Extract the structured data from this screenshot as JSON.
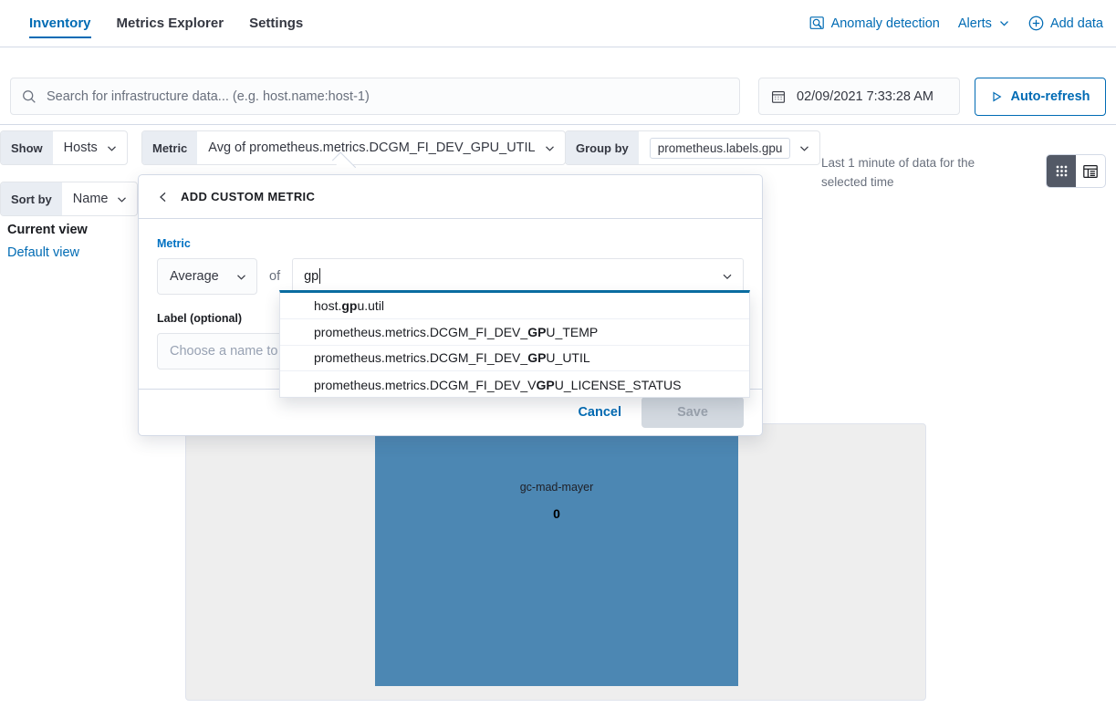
{
  "nav": {
    "tabs": [
      {
        "label": "Inventory",
        "active": true
      },
      {
        "label": "Metrics Explorer",
        "active": false
      },
      {
        "label": "Settings",
        "active": false
      }
    ],
    "right": {
      "anomaly_label": "Anomaly detection",
      "alerts_label": "Alerts",
      "add_data_label": "Add data"
    }
  },
  "search": {
    "placeholder": "Search for infrastructure data... (e.g. host.name:host-1)",
    "value": ""
  },
  "date": {
    "value": "02/09/2021 7:33:28 AM"
  },
  "refresh": {
    "label": "Auto-refresh"
  },
  "toolbar": {
    "show_label": "Show",
    "show_value": "Hosts",
    "metric_label": "Metric",
    "metric_value": "Avg of prometheus.metrics.DCGM_FI_DEV_GPU_UTIL",
    "groupby_label": "Group by",
    "groupby_value": "prometheus.labels.gpu",
    "hint": "Last 1 minute of data for the selected time"
  },
  "sidebar": {
    "sort_label": "Sort by",
    "sort_value": "Name",
    "current_view": "Current view",
    "default_view": "Default view"
  },
  "panel": {
    "title": "ADD CUSTOM METRIC",
    "metric_field_label": "Metric",
    "agg_value": "Average",
    "of_text": "of",
    "metric_input_value": "gp",
    "label_field_label": "Label (optional)",
    "label_placeholder": "Choose a name to a",
    "cancel_label": "Cancel",
    "save_label": "Save"
  },
  "suggestions": [
    {
      "prefix": "host.",
      "match": "gp",
      "suffix": "u.util"
    },
    {
      "prefix": "prometheus.metrics.DCGM_FI_DEV_",
      "match": "GP",
      "suffix": "U_TEMP"
    },
    {
      "prefix": "prometheus.metrics.DCGM_FI_DEV_",
      "match": "GP",
      "suffix": "U_UTIL"
    },
    {
      "prefix": "prometheus.metrics.DCGM_FI_DEV_V",
      "match": "GP",
      "suffix": "U_LICENSE_STATUS"
    }
  ],
  "chart_data": {
    "type": "treemap",
    "title": "",
    "categories": [
      "gc-mad-mayer"
    ],
    "values": [
      0
    ],
    "value_labels": [
      "0"
    ],
    "colors": [
      "#4c87b3"
    ],
    "background": "#eeeeee"
  }
}
